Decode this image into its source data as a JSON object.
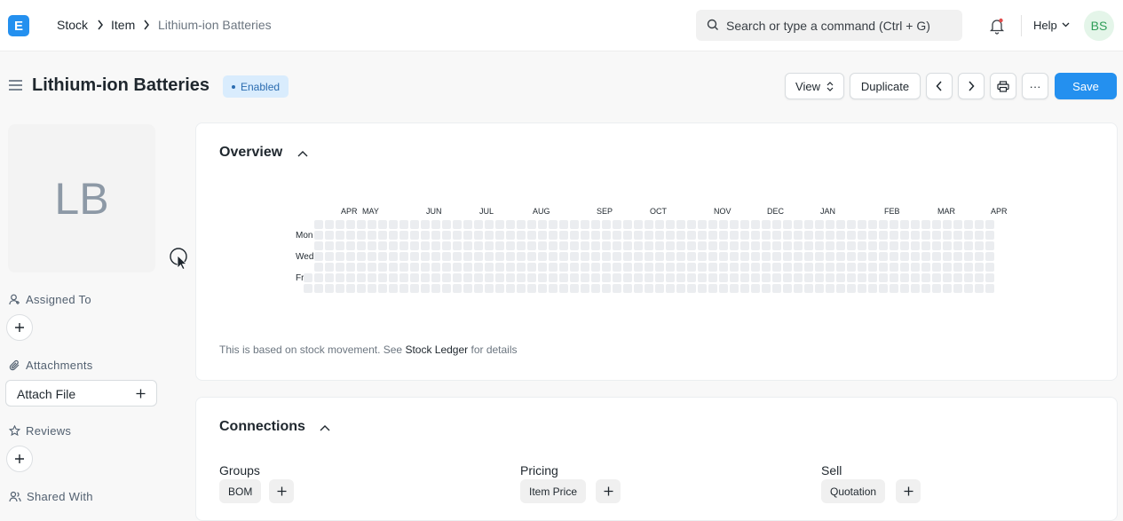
{
  "app": {
    "logo_letter": "E"
  },
  "breadcrumb": [
    "Stock",
    "Item",
    "Lithium-ion Batteries"
  ],
  "search": {
    "placeholder": "Search or type a command (Ctrl + G)"
  },
  "navbar": {
    "help_label": "Help",
    "avatar_initials": "BS"
  },
  "page": {
    "title": "Lithium-ion Batteries",
    "status": "Enabled"
  },
  "toolbar": {
    "view_label": "View",
    "duplicate_label": "Duplicate",
    "more_label": "···",
    "save_label": "Save"
  },
  "sidebar": {
    "image_initials": "LB",
    "assigned_to_label": "Assigned To",
    "attachments_label": "Attachments",
    "attach_file_label": "Attach File",
    "reviews_label": "Reviews",
    "shared_with_label": "Shared With"
  },
  "overview": {
    "title": "Overview",
    "months": [
      "APR",
      "MAY",
      "JUN",
      "JUL",
      "AUG",
      "SEP",
      "OCT",
      "NOV",
      "DEC",
      "JAN",
      "FEB",
      "MAR",
      "APR"
    ],
    "days": [
      "Mon",
      "Wed",
      "Fri"
    ],
    "footnote_prefix": "This is based on stock movement. See ",
    "footnote_link": "Stock Ledger",
    "footnote_suffix": " for details"
  },
  "connections": {
    "title": "Connections",
    "groups": [
      {
        "title": "Groups",
        "item": "BOM"
      },
      {
        "title": "Pricing",
        "item": "Item Price"
      },
      {
        "title": "Sell",
        "item": "Quotation"
      }
    ]
  },
  "colors": {
    "accent": "#2490ef",
    "status_bg": "#d9ecfd",
    "heat_empty": "#ebedf0"
  }
}
